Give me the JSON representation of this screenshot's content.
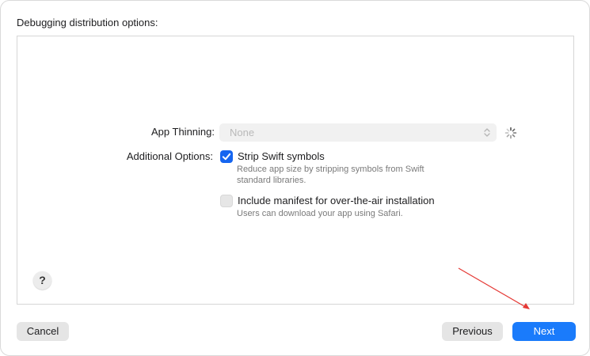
{
  "dialog": {
    "section_title": "Debugging distribution options:"
  },
  "app_thinning": {
    "label": "App Thinning:",
    "selected_value": "None"
  },
  "additional_options": {
    "label": "Additional Options:",
    "options": [
      {
        "label": "Strip Swift symbols",
        "description": "Reduce app size by stripping symbols from Swift standard libraries.",
        "checked": true
      },
      {
        "label": "Include manifest for over-the-air installation",
        "description": "Users can download your app using Safari.",
        "checked": false
      }
    ]
  },
  "help": {
    "label": "?"
  },
  "footer": {
    "cancel_label": "Cancel",
    "previous_label": "Previous",
    "next_label": "Next"
  },
  "colors": {
    "accent": "#1a7bfb",
    "checkbox_on": "#1565f0",
    "annotation_arrow": "#e53935"
  },
  "icons": {
    "select_chevron": "chevron-up-down-icon",
    "loading": "spinner-icon",
    "checkmark": "checkmark-icon"
  }
}
